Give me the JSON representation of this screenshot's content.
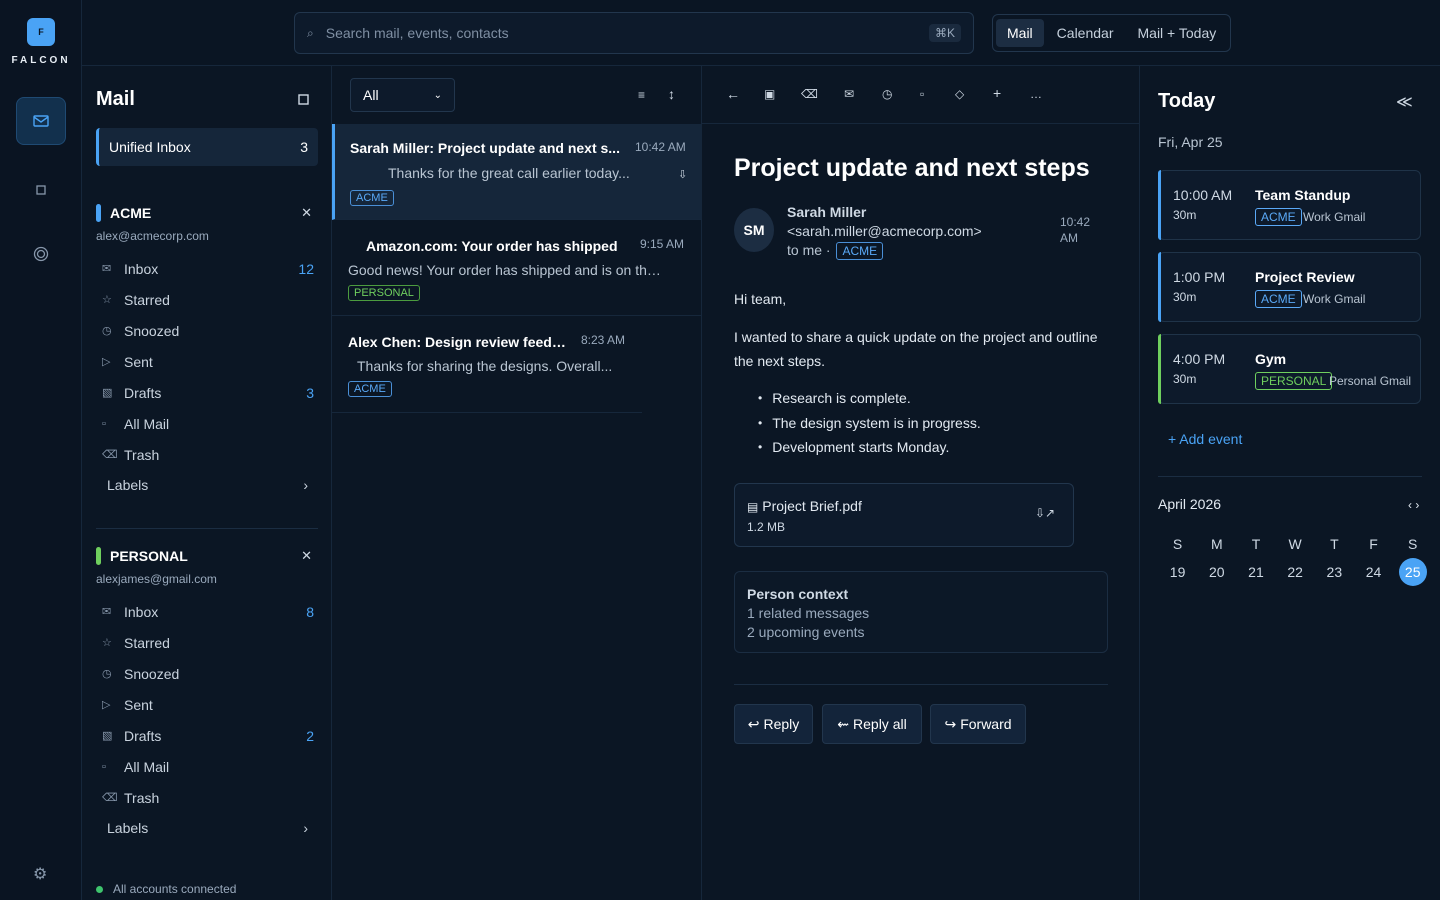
{
  "app": {
    "logo_letter": "F",
    "name": "FALCON"
  },
  "rail": {
    "mail_icon": "mail-icon",
    "calendar_icon": "square-icon",
    "contacts_icon": "target-icon",
    "settings_icon": "gear-icon"
  },
  "search": {
    "placeholder": "Search mail, events, contacts",
    "shortcut": "⌘K"
  },
  "view_switch": {
    "items": [
      "Mail",
      "Calendar",
      "Mail + Today"
    ],
    "active": "Mail"
  },
  "sidebar": {
    "title": "Mail",
    "unified": {
      "label": "Unified Inbox",
      "count": "3"
    },
    "accounts": [
      {
        "name": "ACME",
        "email": "alex@acmecorp.com",
        "color": "#4aa3f5",
        "folders": [
          {
            "icon": "✉",
            "label": "Inbox",
            "count": "12"
          },
          {
            "icon": "☆",
            "label": "Starred",
            "count": ""
          },
          {
            "icon": "◷",
            "label": "Snoozed",
            "count": ""
          },
          {
            "icon": "▷",
            "label": "Sent",
            "count": ""
          },
          {
            "icon": "▧",
            "label": "Drafts",
            "count": "3"
          },
          {
            "icon": "▫",
            "label": "All Mail",
            "count": ""
          },
          {
            "icon": "⌫",
            "label": "Trash",
            "count": ""
          }
        ],
        "labels": "Labels"
      },
      {
        "name": "PERSONAL",
        "email": "alexjames@gmail.com",
        "color": "#6fcf5e",
        "folders": [
          {
            "icon": "✉",
            "label": "Inbox",
            "count": "8"
          },
          {
            "icon": "☆",
            "label": "Starred",
            "count": ""
          },
          {
            "icon": "◷",
            "label": "Snoozed",
            "count": ""
          },
          {
            "icon": "▷",
            "label": "Sent",
            "count": ""
          },
          {
            "icon": "▧",
            "label": "Drafts",
            "count": "2"
          },
          {
            "icon": "▫",
            "label": "All Mail",
            "count": ""
          },
          {
            "icon": "⌫",
            "label": "Trash",
            "count": ""
          }
        ],
        "labels": "Labels"
      }
    ],
    "status": "All accounts connected"
  },
  "list": {
    "filter": "All",
    "messages": [
      {
        "from": "Sarah Miller: Project update and next s...",
        "time": "10:42 AM",
        "snippet": "Thanks for the great call earlier today...",
        "tag": "ACME"
      },
      {
        "from": "Amazon.com: Your order has shipped",
        "time": "9:15 AM",
        "snippet": "Good news! Your order has shipped and is on the ...",
        "tag": "PERSONAL"
      },
      {
        "from": "Alex Chen: Design review feedback",
        "time": "8:23 AM",
        "snippet": "Thanks for sharing the designs. Overall...",
        "tag": "ACME"
      }
    ]
  },
  "reader": {
    "subject": "Project update and next steps",
    "avatar": "SM",
    "sender_name": "Sarah Miller",
    "sender_email": "<sarah.miller@acmecorp.com>",
    "to": "to me ·",
    "tag": "ACME",
    "time": "10:42 AM",
    "greeting": "Hi team,",
    "paragraph": "I wanted to share a quick update on the project and outline the next steps.",
    "bullets": [
      "Research is complete.",
      "The design system is in progress.",
      "Development starts Monday."
    ],
    "attachment": {
      "name": "Project Brief.pdf",
      "size": "1.2 MB"
    },
    "person_context": {
      "title": "Person context",
      "line1": "1 related messages",
      "line2": "2 upcoming events"
    },
    "actions": {
      "reply": "Reply",
      "reply_all": "Reply all",
      "forward": "Forward"
    }
  },
  "today": {
    "title": "Today",
    "date": "Fri, Apr 25",
    "events": [
      {
        "time": "10:00 AM",
        "duration": "30m",
        "title": "Team Standup",
        "tag": "ACME",
        "calendar": "Work Gmail",
        "color": "#4aa3f5"
      },
      {
        "time": "1:00 PM",
        "duration": "30m",
        "title": "Project Review",
        "tag": "ACME",
        "calendar": "Work Gmail",
        "color": "#4aa3f5"
      },
      {
        "time": "4:00 PM",
        "duration": "30m",
        "title": "Gym",
        "tag": "PERSONAL",
        "calendar": "Personal Gmail",
        "color": "#6fcf5e"
      }
    ],
    "add_event": "+ Add event",
    "calendar": {
      "month": "April 2026",
      "weekdays": [
        "S",
        "M",
        "T",
        "W",
        "T",
        "F",
        "S"
      ],
      "days": [
        "19",
        "20",
        "21",
        "22",
        "23",
        "24",
        "25"
      ],
      "selected": "25"
    }
  }
}
